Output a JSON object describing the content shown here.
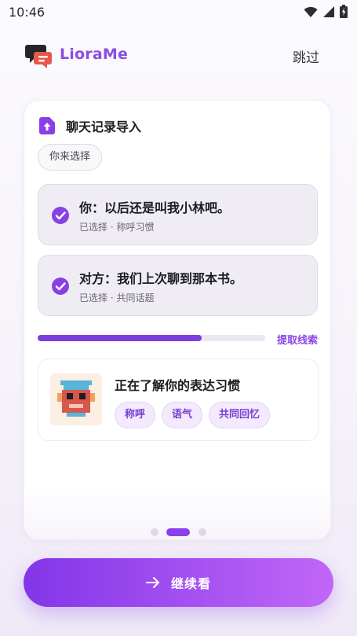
{
  "status_bar": {
    "time": "10:46",
    "icons": [
      "wifi-icon",
      "signal-icon",
      "battery-icon"
    ]
  },
  "header": {
    "app_name": "LioraMe",
    "skip_label": "跳过"
  },
  "card": {
    "title": "聊天记录导入",
    "choose_chip": "你来选择",
    "messages": [
      {
        "text": "你：以后还是叫我小林吧。",
        "sub": "已选择 · 称呼习惯"
      },
      {
        "text": "对方：我们上次聊到那本书。",
        "sub": "已选择 · 共同话题"
      }
    ],
    "progress": {
      "value": 0.72,
      "label": "提取线索"
    },
    "habit": {
      "title": "正在了解你的表达习惯",
      "tags": [
        "称呼",
        "语气",
        "共同回忆"
      ]
    }
  },
  "pager": {
    "count": 3,
    "active": 1
  },
  "continue_label": "继续看",
  "colors": {
    "brand": "#8b4be6",
    "accent": "#7f3de0",
    "button_gradient": [
      "#8336e8",
      "#c166f8"
    ]
  }
}
